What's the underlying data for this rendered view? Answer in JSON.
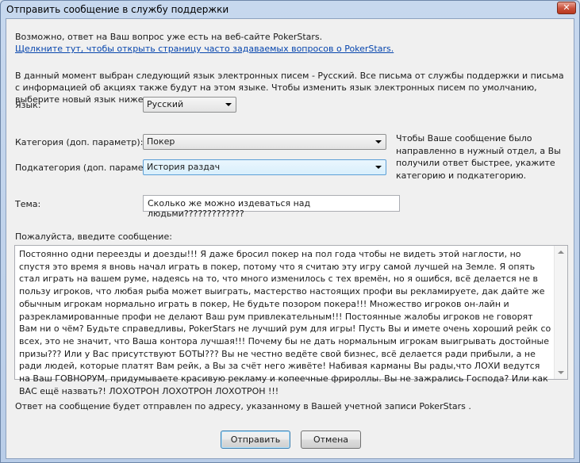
{
  "window": {
    "title": "Отправить сообщение в службу поддержки",
    "close_glyph": "✕"
  },
  "faq": {
    "intro": "Возможно, ответ на Ваш вопрос уже есть на веб-сайте PokerStars.",
    "link": "Щелкните тут, чтобы открыть страницу часто задаваемых вопросов о PokerStars."
  },
  "language_info": "В данный момент выбран следующий язык электронных писем - Русский. Все письма от службы поддержки и письма с информацией об акциях также будут на этом языке. Чтобы изменить язык электронных писем по умолчанию, выберите новый язык ниже.",
  "language": {
    "label": "Язык:",
    "value": "Русский"
  },
  "category": {
    "label": "Категория (доп. параметр):",
    "value": "Покер"
  },
  "subcategory": {
    "label": "Подкатегория (доп. параметр):",
    "value": "История раздач"
  },
  "category_hint": "Чтобы Ваше сообщение было направленно в нужный отдел, а Вы получили ответ быстрее, укажите категорию и подкатегорию.",
  "subject": {
    "label": "Тема:",
    "value": "Сколько же можно издеваться над людьми?????????????"
  },
  "message": {
    "label": "Пожалуйста, введите сообщение:",
    "value": "Постоянно одни переезды и доезды!!! Я даже бросил покер на пол года чтобы не видеть этой наглости, но спустя это время я вновь начал играть в покер, потому что я считаю эту игру самой лучшей на Земле. Я опять стал играть на вашем руме, надеясь на то, что много изменилось с тех времён, но я ошибся, всё делается не в пользу игроков, что любая рыба может выиграть, мастерство настоящих профи вы рекламируете, дак дайте же обычным игрокам нормально играть в покер, Не будьте позором покера!!! Множество игроков он-лайн и разрекламированные профи не делают Ваш рум привлекательным!!! Постоянные жалобы игроков не говорят Вам ни о чём? Будьте справедливы, PokerStars не лучший рум для игры! Пусть Вы и имете очень хороший рейк со всех, это не значит, что Ваша контора лучшая!!! Почему бы не дать нормальным игрокам выигрывать достойные призы??? Или у Вас присутствуют БОТЫ??? Вы не честно ведёте свой бизнес, всё делается ради прибыли, а не ради людей, которые платят Вам рейк, а Вы за счёт него живёте! Набивая карманы Вы рады,что ЛОХИ ведутся на Ваш ГОВНОРУМ, придумываете красивую рекламу и копеечные фрироллы. Вы не зажрались Господа? Или как ВАС ещё назвать?! ЛОХОТРОН ЛОХОТРОН ЛОХОТРОН !!!"
  },
  "reply_note": "Ответ на сообщение будет отправлен по адресу, указанному в Вашей учетной записи PokerStars .",
  "buttons": {
    "send": "Отправить",
    "cancel": "Отмена"
  }
}
